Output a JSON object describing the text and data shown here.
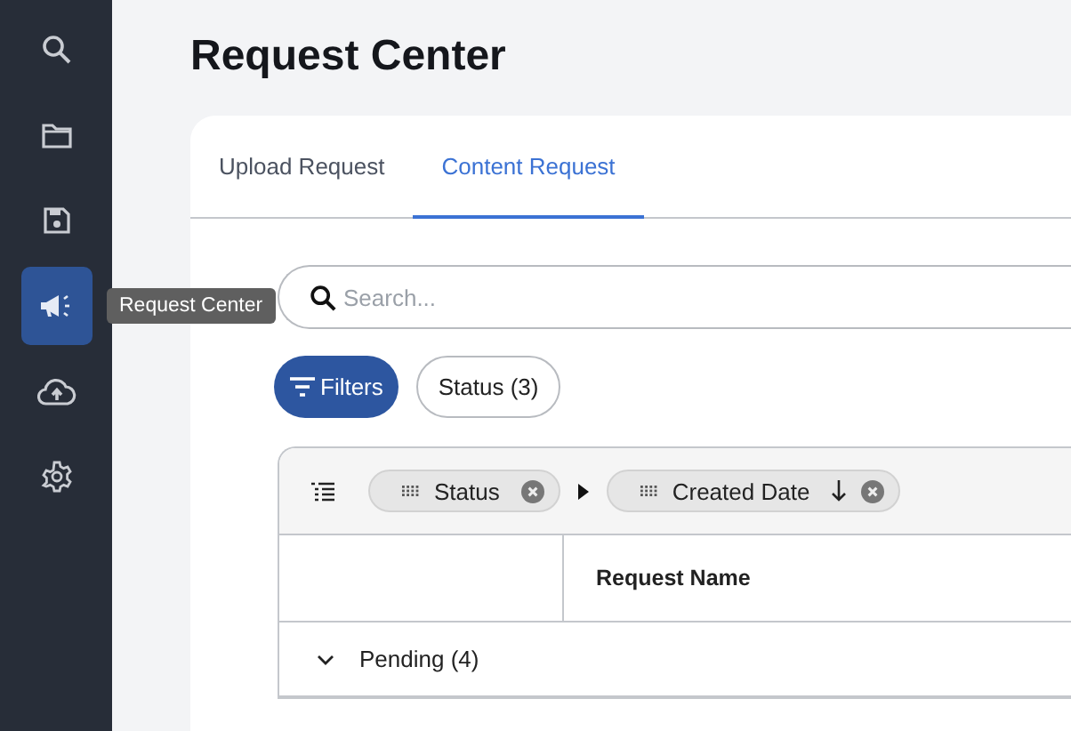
{
  "sidebar": {
    "items": [
      {
        "kind": "search",
        "selected": false
      },
      {
        "kind": "folder",
        "selected": false
      },
      {
        "kind": "save",
        "selected": false
      },
      {
        "kind": "megaphone",
        "selected": true
      },
      {
        "kind": "upload",
        "selected": false
      },
      {
        "kind": "settings",
        "selected": false
      }
    ]
  },
  "tooltip": "Request Center",
  "title": "Request Center",
  "tabs": [
    {
      "label": "Upload Request",
      "selected": false
    },
    {
      "label": "Content Request",
      "selected": true
    }
  ],
  "search": {
    "placeholder": "Search..."
  },
  "filters_button": "Filters",
  "status_chip": "Status (3)",
  "grouping": [
    {
      "label": "Status",
      "sorted": false
    },
    {
      "label": "Created Date",
      "sorted": true
    }
  ],
  "table": {
    "columns": [
      "Request Name"
    ],
    "groups": [
      {
        "label": "Pending (4)",
        "expanded": true
      }
    ]
  }
}
